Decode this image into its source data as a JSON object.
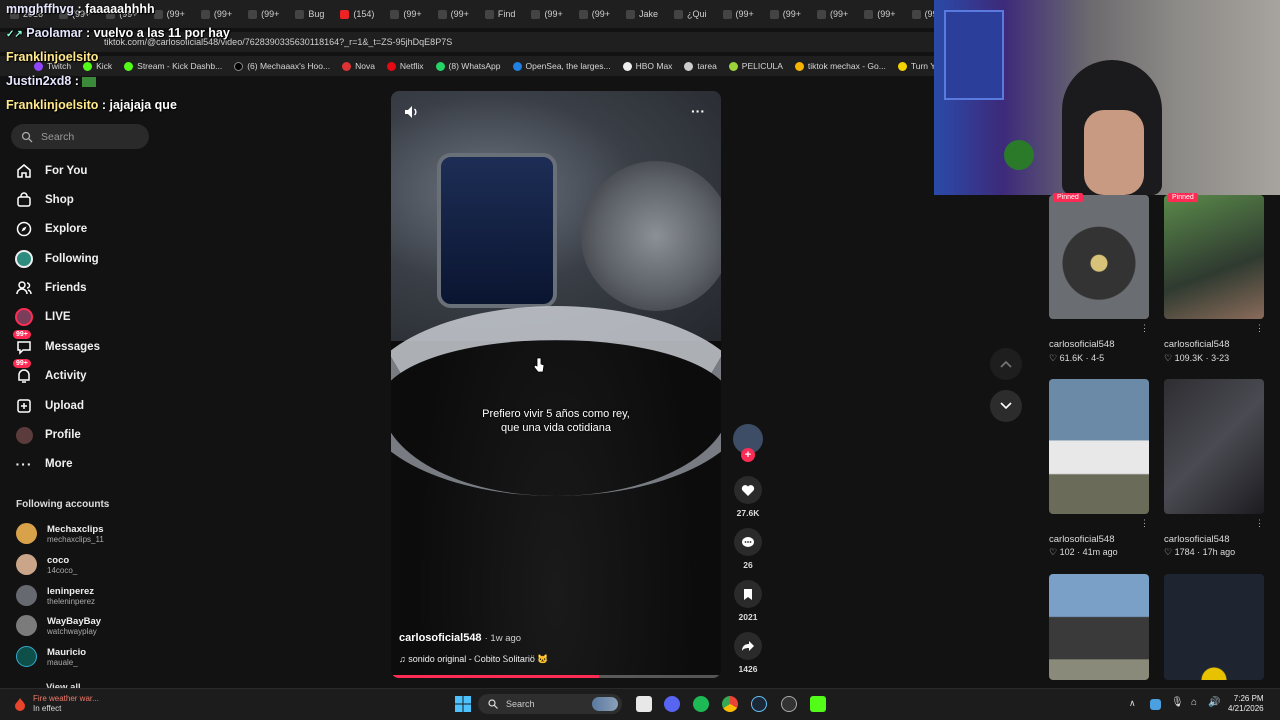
{
  "browser": {
    "tabs": [
      "2026",
      "(99+",
      "(99+",
      "(99+",
      "(99+",
      "(99+",
      "Bug",
      "(154)",
      "(99+",
      "(99+",
      "Find",
      "(99+",
      "(99+",
      "Jake",
      "¿Qui",
      "(99+",
      "(99+",
      "(99+",
      "(99+",
      "(99+"
    ],
    "url": "tiktok.com/@carlosoficial548/video/7628390335630118164?_r=1&_t=ZS-95jhDqE8P7S",
    "bookmarks": [
      "Twitch",
      "Kick",
      "Stream - Kick Dashb...",
      "(6) Mechaaax's Hoo...",
      "Nova",
      "Netflix",
      "(8) WhatsApp",
      "OpenSea, the larges...",
      "HBO Max",
      "tarea",
      "PELICULA",
      "tiktok mechax - Go...",
      "Turn You"
    ]
  },
  "chat": [
    {
      "user": "mmghffhvg",
      "sep": " : ",
      "msg": "faaaaahhhh"
    },
    {
      "user": "Paolamar",
      "sep": " : ",
      "msg": "vuelvo a las 11 por hay"
    },
    {
      "user": "Franklinjoelsito",
      "sep": "",
      "msg": ""
    },
    {
      "user": "Justin2xd8",
      "sep": " : ",
      "msg": ""
    },
    {
      "user": "Franklinjoelsito",
      "sep": " : ",
      "msg": "jajajaja que"
    }
  ],
  "sidebar": {
    "search_placeholder": "Search",
    "nav": [
      {
        "label": "For You",
        "icon": "home-icon"
      },
      {
        "label": "Shop",
        "icon": "shop-icon"
      },
      {
        "label": "Explore",
        "icon": "compass-icon"
      },
      {
        "label": "Following",
        "icon": "following-icon"
      },
      {
        "label": "Friends",
        "icon": "friends-icon"
      },
      {
        "label": "LIVE",
        "icon": "live-icon"
      },
      {
        "label": "Messages",
        "icon": "messages-icon",
        "badge": "99+"
      },
      {
        "label": "Activity",
        "icon": "activity-icon",
        "badge": "99+"
      },
      {
        "label": "Upload",
        "icon": "upload-icon"
      },
      {
        "label": "Profile",
        "icon": "profile-icon"
      },
      {
        "label": "More",
        "icon": "more-icon"
      }
    ],
    "following_title": "Following accounts",
    "accounts": [
      {
        "name": "Mechaxclips",
        "handle": "mechaxclips_11",
        "color": "#d8a24a"
      },
      {
        "name": "coco",
        "handle": "14coco_",
        "color": "#caa58a"
      },
      {
        "name": "leninperez",
        "handle": "theleninperez",
        "color": "#666a70"
      },
      {
        "name": "WayBayBay",
        "handle": "watchwayplay",
        "color": "#7b7b7b"
      },
      {
        "name": "Mauricio",
        "handle": "mauale_",
        "color": "#0f4f4a"
      }
    ],
    "view_all": "View all"
  },
  "video": {
    "subtitle_line1": "Prefiero vivir 5 años como rey,",
    "subtitle_line2": "que una vida cotidiana",
    "author": "carlosoficial548",
    "age": "· 1w ago",
    "sound": "sonido original - Ꮯobito Ꮪolitariö 🐱",
    "progress": 0.63
  },
  "actions": {
    "likes": "27.6K",
    "comments": "26",
    "saves": "2021",
    "shares": "1426"
  },
  "grid": [
    {
      "user": "carlosoficial548",
      "meta": "♡ 61.6K · 4-5",
      "pinned": "Pinned",
      "color": "#4a4d52"
    },
    {
      "user": "carlosoficial548",
      "meta": "♡ 109.3K · 3-23",
      "pinned": "Pinned",
      "color": "#3c4a3a"
    },
    {
      "user": "carlosoficial548",
      "meta": "♡ 102 · 41m ago",
      "pinned": "",
      "color": "#6b8aa8"
    },
    {
      "user": "carlosoficial548",
      "meta": "♡ 1784 · 17h ago",
      "pinned": "",
      "color": "#3a3a3e"
    },
    {
      "user": "",
      "meta": "",
      "pinned": "",
      "color": "#7aa0c8"
    },
    {
      "user": "",
      "meta": "",
      "pinned": "",
      "color": "#1e2430"
    }
  ],
  "taskbar": {
    "weather_title": "Fire weather war...",
    "weather_sub": "In effect",
    "search": "Search",
    "time": "7:26 PM",
    "date": "4/21/2026"
  },
  "colors": {
    "accent": "#fe2c55",
    "bg": "#121212"
  }
}
